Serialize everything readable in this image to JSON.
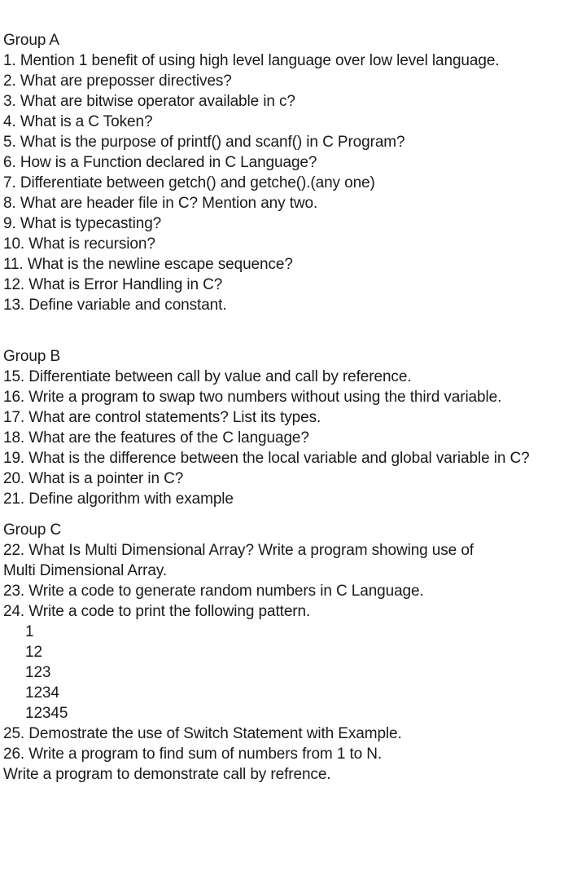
{
  "groups": [
    {
      "title": "Group A",
      "lines": [
        "1. Mention 1 benefit of using high level language over low level language.",
        "2. What are preposser directives?",
        "3. What are bitwise operator available in c?",
        "4. What is a C Token?",
        "5. What is the purpose of printf() and scanf() in C Program?",
        "6. How is a Function declared in C Language?",
        "7.  Differentiate between getch() and getche().(any one)",
        "8. What are header file in C? Mention any two.",
        "9. What is typecasting?",
        "10. What is recursion?",
        "11. What is the newline escape sequence?",
        "12. What is Error Handling in C?",
        "13. Define variable and constant."
      ]
    },
    {
      "title": "Group B",
      "lines": [
        "15. Differentiate between call by value and call by reference.",
        "16. Write a program to swap two numbers without using the third variable.",
        "17. What are control statements? List its types.",
        "18. What are the features of the C language?",
        "19. What is the difference between the local variable and global variable in C?",
        "20. What is a pointer in C?",
        "21. Define algorithm with example"
      ]
    },
    {
      "title": "Group C",
      "lines_before_pattern": [
        "22. What Is Multi Dimensional Array? Write a program showing use of",
        "Multi Dimensional Array.",
        "23. Write a code to generate random numbers in C Language.",
        "24. Write a code to print the following pattern."
      ],
      "pattern": [
        "1",
        "12",
        "123",
        "1234",
        "12345"
      ],
      "lines_after_pattern": [
        "25. Demostrate the use of Switch Statement with Example.",
        "26. Write a program to find sum of numbers from 1 to N.",
        "Write a program to demonstrate call by refrence."
      ]
    }
  ]
}
